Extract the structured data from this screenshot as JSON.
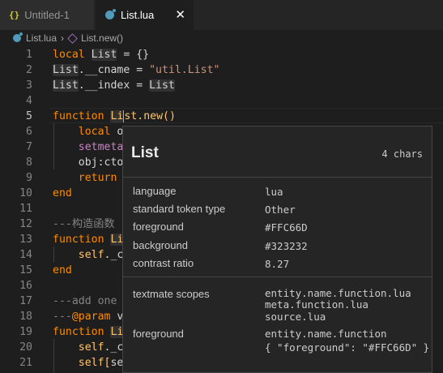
{
  "tabs": [
    {
      "label": "Untitled-1",
      "icon": "json-braces-icon"
    },
    {
      "label": "List.lua",
      "icon": "lua-icon",
      "active": true
    }
  ],
  "breadcrumb": {
    "file": "List.lua",
    "symbol": "List.new()"
  },
  "line_numbers": [
    "1",
    "2",
    "3",
    "4",
    "5",
    "6",
    "7",
    "8",
    "9",
    "10",
    "11",
    "12",
    "13",
    "14",
    "15",
    "16",
    "17",
    "18",
    "19",
    "20",
    "21"
  ],
  "code": {
    "l1": {
      "kw": "local",
      "id": "List",
      "rest": " = {}"
    },
    "l2": {
      "a": "List",
      "b": ".__cname = ",
      "str": "\"util.List\""
    },
    "l3": {
      "a": "List",
      "b": ".__index = ",
      "c": "List"
    },
    "l5": {
      "kw": "function",
      "a": "Li",
      "b": "st",
      "fn": ".new()"
    },
    "l6": {
      "kw": "local",
      "rest": " o"
    },
    "l7": {
      "rest": "setmeta"
    },
    "l8": {
      "rest": "obj:cto"
    },
    "l9": {
      "kw": "return"
    },
    "l10": {
      "kw": "end"
    },
    "l12": {
      "cmt": "---构造函数"
    },
    "l13": {
      "kw": "function",
      "a": "Li"
    },
    "l14": {
      "a": "self",
      "b": "._c"
    },
    "l15": {
      "kw": "end"
    },
    "l17": {
      "cmt": "---add one"
    },
    "l18": {
      "cmt": "---",
      "param": "@param",
      "rest": " v"
    },
    "l19": {
      "kw": "function",
      "a": "Li"
    },
    "l20": {
      "a": "self",
      "b": "._c"
    },
    "l21": {
      "a": "self",
      "b": "[",
      "c": "se"
    }
  },
  "hover": {
    "title": "List",
    "count": "4 chars",
    "rows": [
      {
        "label": "language",
        "value": "lua"
      },
      {
        "label": "standard token type",
        "value": "Other"
      },
      {
        "label": "foreground",
        "value": "#FFC66D"
      },
      {
        "label": "background",
        "value": "#323232"
      },
      {
        "label": "contrast ratio",
        "value": "8.27"
      }
    ],
    "scopes_label": "textmate scopes",
    "scopes": [
      "entity.name.function.lua",
      "meta.function.lua",
      "source.lua"
    ],
    "fg_label": "foreground",
    "fg_scope": "entity.name.function",
    "fg_json": "{ \"foreground\": \"#FFC66D\" }"
  },
  "colors": {
    "keyword": "#c586c0",
    "function": "#ffc66d",
    "string": "#ce9178",
    "comment": "#848484",
    "highlight": "#323232"
  }
}
